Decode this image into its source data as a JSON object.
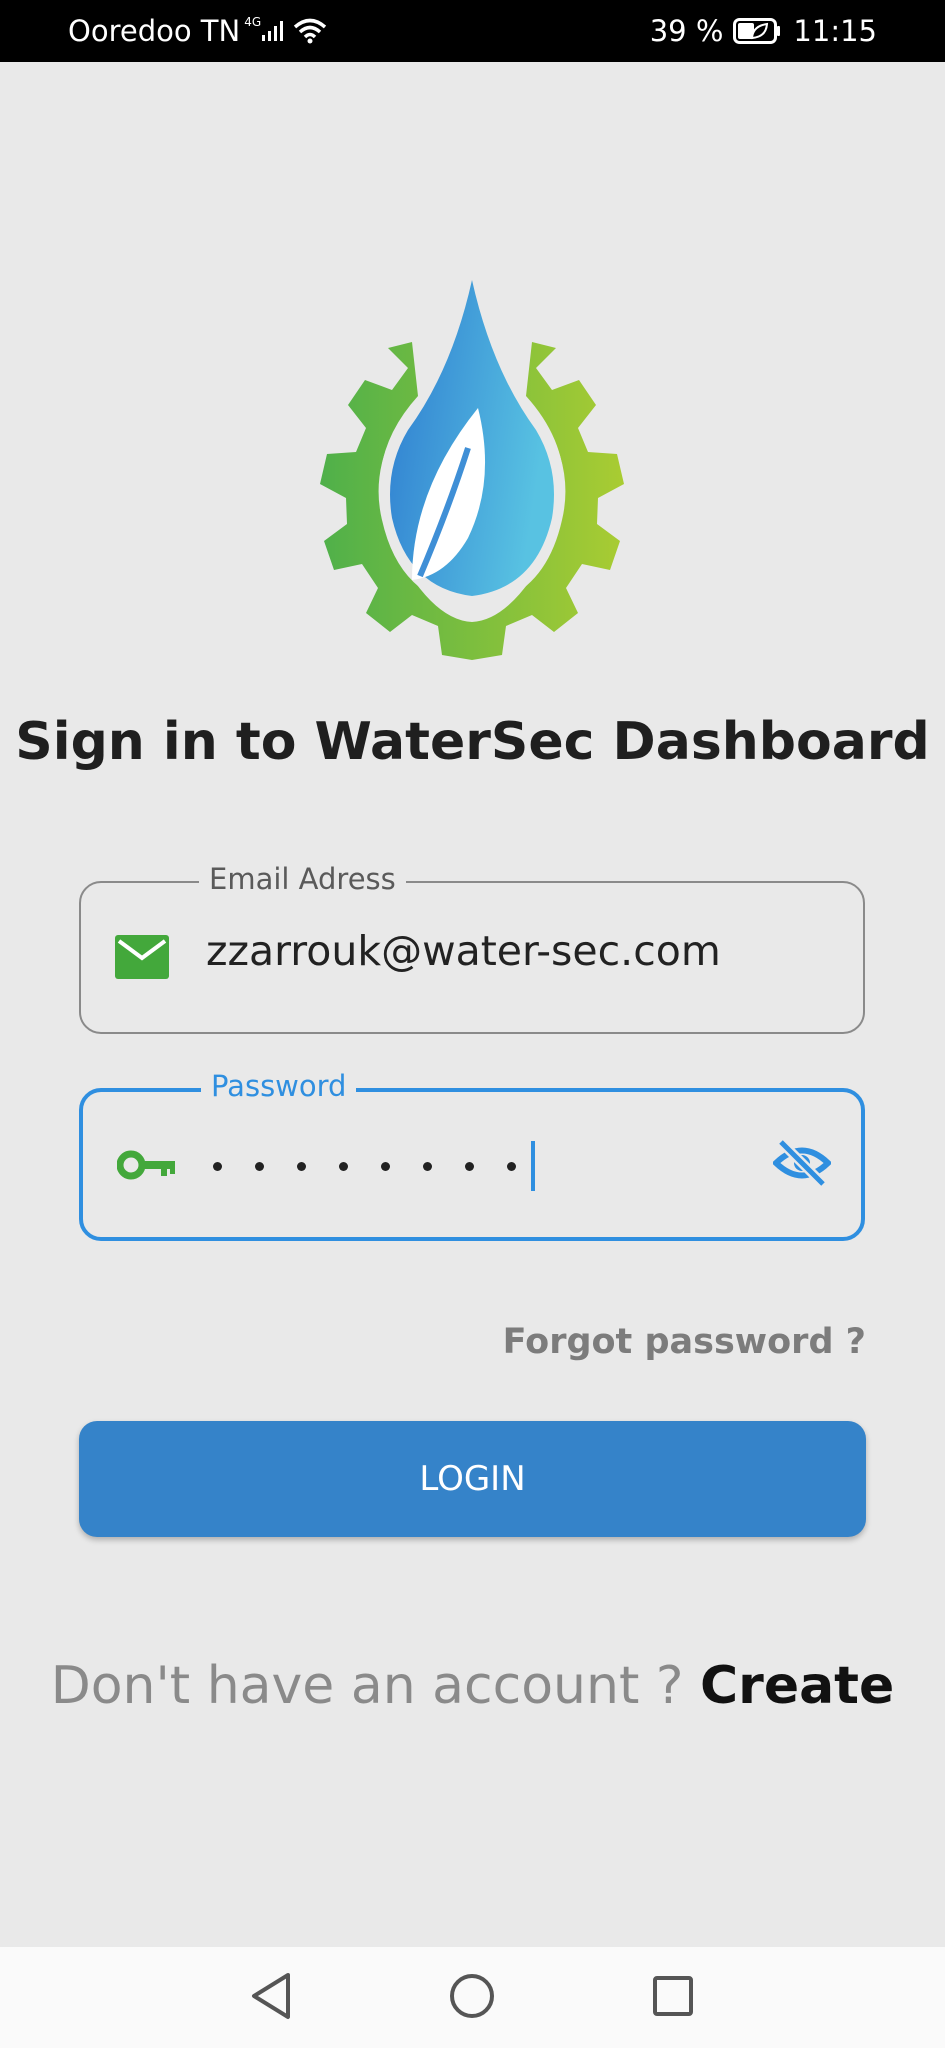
{
  "status_bar": {
    "carrier": "Ooredoo TN",
    "network": "4G",
    "battery": "39 %",
    "time": "11:15",
    "icons": [
      "signal-icon",
      "wifi-icon",
      "battery-icon",
      "battery-saver-leaf-icon"
    ]
  },
  "logo": {
    "icon": "watersec-logo-gear-drop-leaf",
    "colors": {
      "gear_green": "#6cbf3c",
      "drop_blue": "#3f8fd6"
    }
  },
  "title": "Sign in to WaterSec Dashboard",
  "email_field": {
    "label": "Email Adress",
    "value": "zzarrouk@water-sec.com",
    "icon": "mail-icon"
  },
  "password_field": {
    "label": "Password",
    "masked_length": 8,
    "icon": "key-icon",
    "toggle_icon": "eye-off-icon",
    "focused": true
  },
  "forgot_password": "Forgot password ?",
  "login_button": "LOGIN",
  "signup": {
    "prompt": "Don't have an account ?",
    "link": "Create"
  },
  "nav_bar": {
    "buttons": [
      "back-icon",
      "home-icon",
      "recents-icon"
    ]
  },
  "colors": {
    "accent": "#2f8fe0",
    "button": "#3583c9",
    "icon_green": "#43a83b",
    "background": "#e9e9e9"
  }
}
